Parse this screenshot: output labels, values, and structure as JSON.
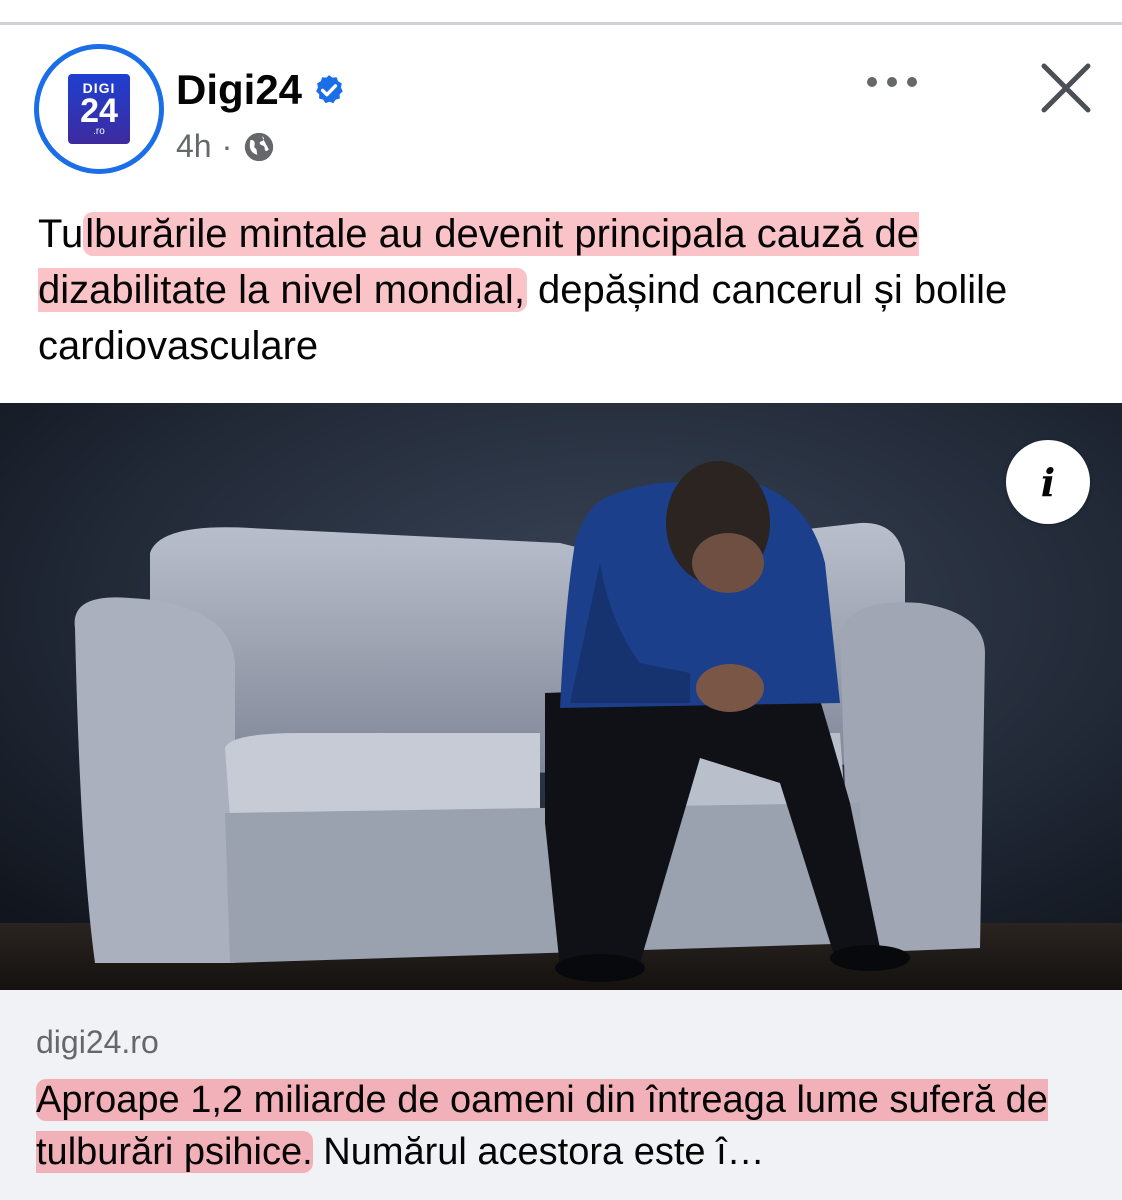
{
  "post": {
    "page_name": "Digi24",
    "avatar": {
      "line1": "DIGI",
      "line2": "24",
      "line3": ".ro"
    },
    "time": "4h",
    "separator": "·",
    "text_part1": "Tu",
    "text_highlight": "lburările mintale au devenit principala cauză de dizabilitate la nivel mondial,",
    "text_part2": " depășind cancerul și bolile cardiovasculare"
  },
  "link": {
    "domain": "digi24.ro",
    "title_highlight": "Aproape 1,2 miliarde de oameni din întreaga lume suferă de tulburări psihice.",
    "title_rest": " Numărul acestora este î…"
  },
  "icons": {
    "verified": "verified-badge-icon",
    "audience": "globe-icon",
    "more": "more-options-icon",
    "close": "close-icon",
    "info": "info-icon"
  },
  "colors": {
    "accent": "#1a6ee8",
    "highlight": "#f47b86",
    "secondary_text": "#65676b",
    "link_background": "#f0f2f5"
  }
}
